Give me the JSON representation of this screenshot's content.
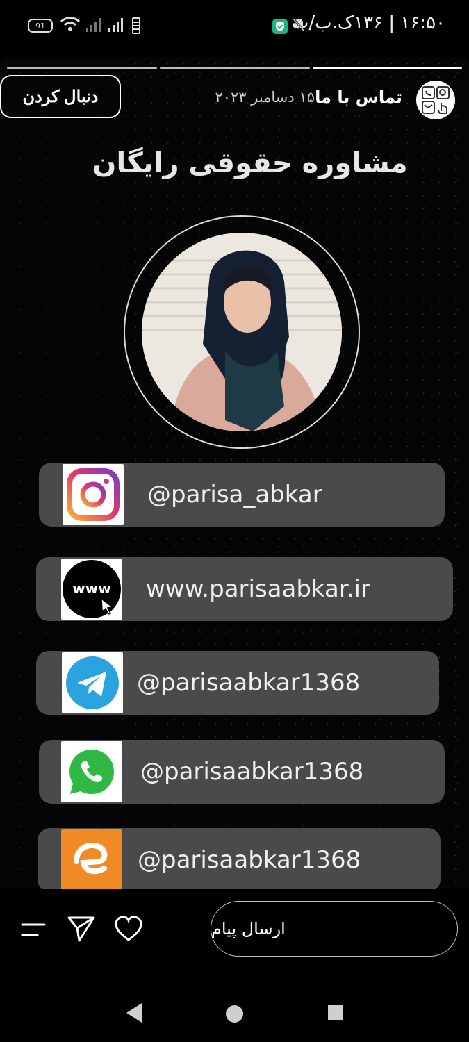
{
  "status_bar": {
    "time": "۱۶:۵۰ | ۱۳۶ک.ب/ث",
    "battery": "91"
  },
  "story": {
    "account_name": "تماس با ما",
    "date": "۱۵ دسامبر ۲۰۲۳",
    "follow_label": "دنبال کردن",
    "headline": "مشاوره حقوقی رایگان",
    "links": [
      {
        "icon": "instagram-icon",
        "text": "@parisa_abkar"
      },
      {
        "icon": "www-icon",
        "text": "www.parisaabkar.ir"
      },
      {
        "icon": "telegram-icon",
        "text": "@parisaabkar1368"
      },
      {
        "icon": "whatsapp-icon",
        "text": "@parisaabkar1368"
      },
      {
        "icon": "eitaa-icon",
        "text": "@parisaabkar1368"
      }
    ]
  },
  "bottom_bar": {
    "message_placeholder": "ارسال پیام"
  },
  "colors": {
    "background": "#000000",
    "card": "#4a4a4a",
    "telegram": "#2aa3df",
    "whatsapp": "#2fb944",
    "eitaa": "#f08a24",
    "shield": "#1fb47f"
  }
}
